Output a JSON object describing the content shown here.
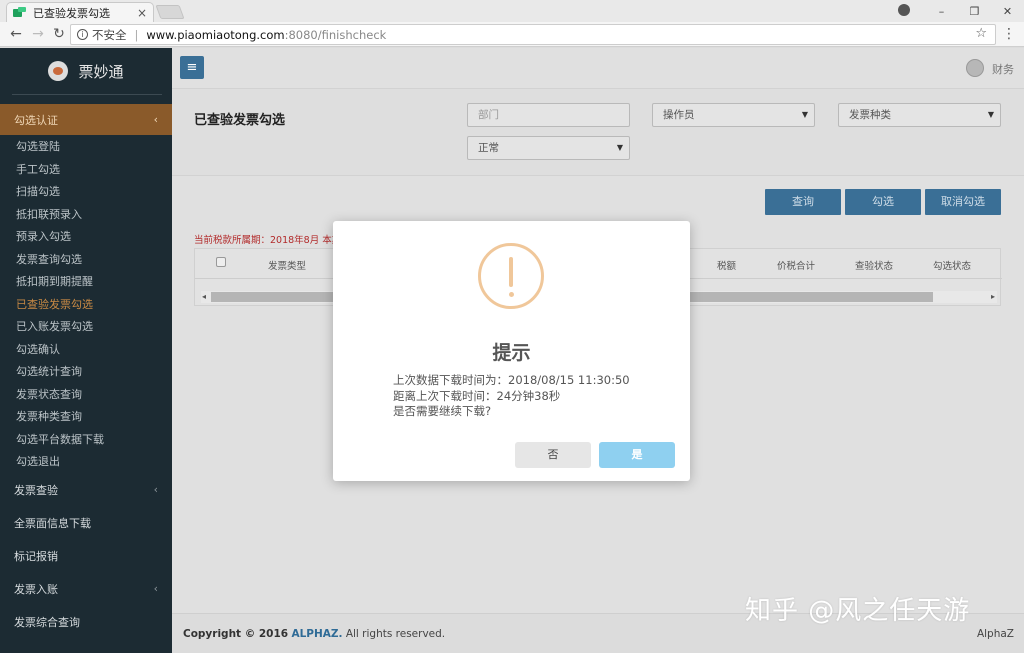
{
  "browser": {
    "tab_title": "已查验发票勾选",
    "tab_close": "×",
    "window_controls": [
      "–",
      "❐",
      "✕"
    ],
    "insecure_label": "不安全",
    "url_host": "www.piaomiaotong.com",
    "url_rest": ":8080/finishcheck"
  },
  "sidebar": {
    "brand": "票妙通",
    "active_group": "勾选认证",
    "items": [
      "勾选登陆",
      "手工勾选",
      "扫描勾选",
      "抵扣联预录入",
      "预录入勾选",
      "发票查询勾选",
      "抵扣期到期提醒",
      "已查验发票勾选",
      "已入账发票勾选",
      "勾选确认",
      "勾选统计查询",
      "发票状态查询",
      "发票种类查询",
      "勾选平台数据下载",
      "勾选退出"
    ],
    "current_index": 7,
    "groups": [
      {
        "label": "发票查验",
        "has_chevron": true
      },
      {
        "label": "全票面信息下载",
        "has_chevron": false
      },
      {
        "label": "标记报销",
        "has_chevron": false
      },
      {
        "label": "发票入账",
        "has_chevron": true
      },
      {
        "label": "发票综合查询",
        "has_chevron": false
      }
    ]
  },
  "topbar": {
    "user": "财务"
  },
  "filters": {
    "title": "已查验发票勾选",
    "department_placeholder": "部门",
    "operator": "操作员",
    "invoice_type": "发票种类",
    "status": "正常"
  },
  "actions": {
    "query": "查询",
    "select": "勾选",
    "cancel_select": "取消勾选"
  },
  "notice": "当前税款所属期：2018年8月 本期",
  "table": {
    "columns": [
      "发票类型",
      "税额",
      "价税合计",
      "查验状态",
      "勾选状态"
    ]
  },
  "footer": {
    "copyright_prefix": "Copyright © 2016",
    "copyright_brand": "ALPHAZ.",
    "copyright_suffix": "All rights reserved.",
    "right_brand": "AlphaZ"
  },
  "modal": {
    "title": "提示",
    "line1": "上次数据下载时间为：2018/08/15 11:30:50",
    "line2": "距离上次下载时间：24分钟38秒",
    "line3": "是否需要继续下载?",
    "no_label": "否",
    "yes_label": "是"
  },
  "watermark": "知乎 @风之任天游",
  "colors": {
    "sidebar_bg": "#1c2b33",
    "active_group_bg": "#8a5a2a",
    "primary_button": "#3a6f96",
    "confirm_button": "#8fd0f0",
    "warning_icon": "#f0c79a",
    "notice_text": "#b22b2b"
  }
}
